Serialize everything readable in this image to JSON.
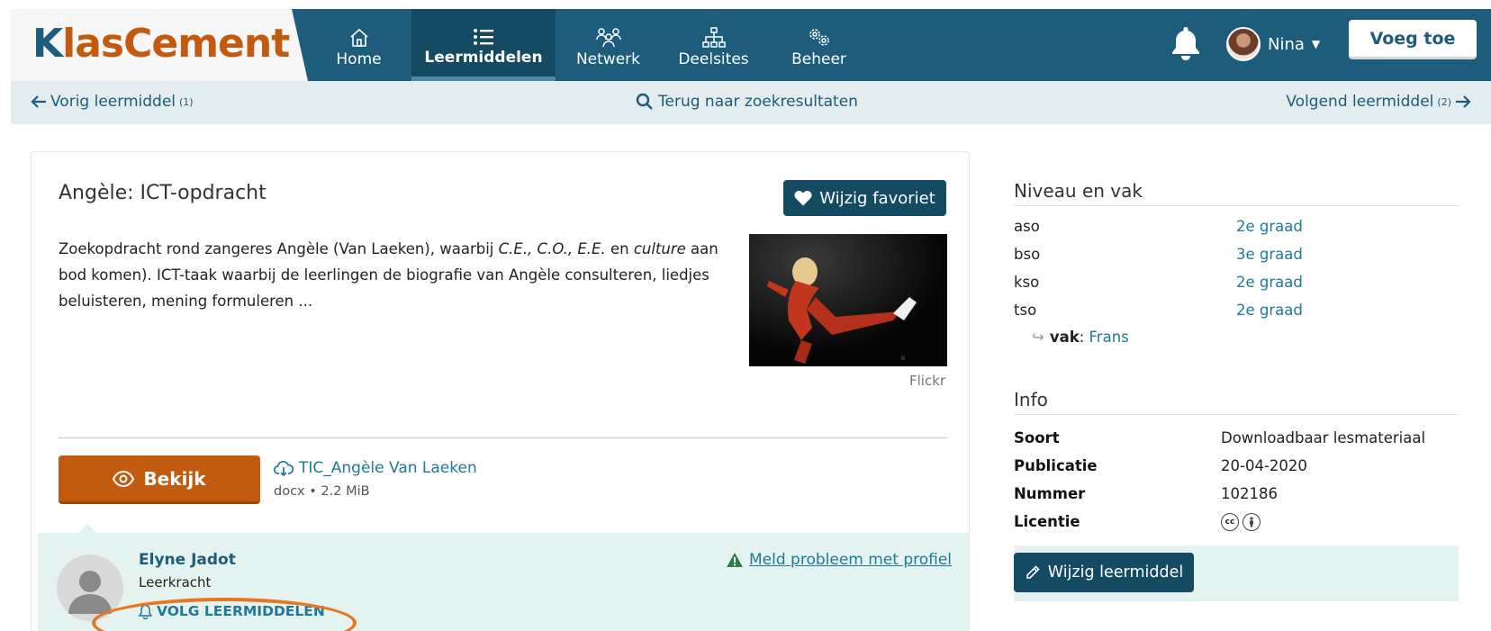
{
  "brand": {
    "logo_k": "K",
    "logo_rest": "lasCement"
  },
  "nav": [
    {
      "label": "Home",
      "icon": "home-icon"
    },
    {
      "label": "Leermiddelen",
      "icon": "list-icon",
      "active": true
    },
    {
      "label": "Netwerk",
      "icon": "people-icon"
    },
    {
      "label": "Deelsites",
      "icon": "sitemap-icon"
    },
    {
      "label": "Beheer",
      "icon": "gears-icon"
    }
  ],
  "user": {
    "name": "Nina"
  },
  "add_button": "Voeg toe",
  "subnav": {
    "prev_label": "Vorig leermiddel",
    "prev_count": "(1)",
    "back_label": "Terug naar zoekresultaten",
    "next_label": "Volgend leermiddel",
    "next_count": "(2)"
  },
  "resource": {
    "title": "Angèle: ICT-opdracht",
    "favorite_button": "Wijzig favoriet",
    "desc_1": "Zoekopdracht rond zangeres Angèle (Van Laeken), waarbij ",
    "desc_2": "C.E., C.O., E.E.",
    "desc_3": " en ",
    "desc_4": "culture",
    "desc_5": " aan bod komen). ICT-taak waarbij de leerlingen de biografie van Angèle consulteren, liedjes beluisteren, mening formuleren ...",
    "image_source": "Flickr",
    "view_button": "Bekijk",
    "file_name": "TIC_Angèle Van Laeken",
    "file_type": "docx",
    "file_sep": "•",
    "file_size": "2.2 MiB"
  },
  "author": {
    "name": "Elyne Jadot",
    "role": "Leerkracht",
    "follow": "VOLG LEERMIDDELEN",
    "report": "Meld probleem met profiel"
  },
  "sidebar": {
    "level_heading": "Niveau en vak",
    "levels": [
      {
        "name": "aso",
        "grade": "2e graad"
      },
      {
        "name": "bso",
        "grade": "3e graad"
      },
      {
        "name": "kso",
        "grade": "2e graad"
      },
      {
        "name": "tso",
        "grade": "2e graad"
      }
    ],
    "vak_arrow": "↪",
    "vak_label": "vak",
    "vak_colon": ":",
    "vak_value": "Frans",
    "info_heading": "Info",
    "info": [
      {
        "key": "Soort",
        "value": "Downloadbaar lesmateriaal"
      },
      {
        "key": "Publicatie",
        "value": "20-04-2020"
      },
      {
        "key": "Nummer",
        "value": "102186"
      },
      {
        "key": "Licentie",
        "value": ""
      }
    ],
    "license_icons": [
      "cc",
      "by"
    ],
    "edit_button": "Wijzig leermiddel"
  },
  "colors": {
    "header": "#1d5c7a",
    "accent_orange": "#c25a0f",
    "link": "#1d7a9a",
    "highlight_ring": "#e87722"
  }
}
